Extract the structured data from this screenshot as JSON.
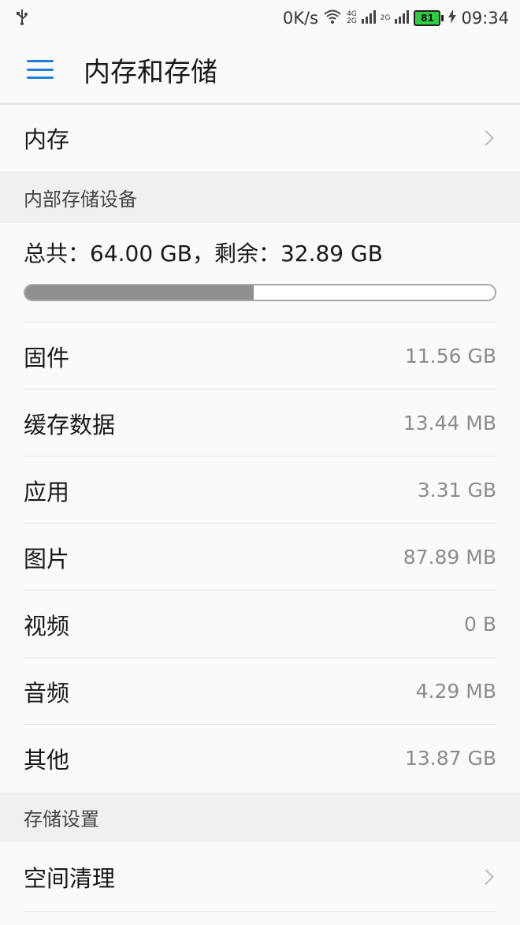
{
  "status_bar": {
    "usb_icon": "usb-icon",
    "net_speed": "0K/s",
    "wifi_icon": "wifi-icon",
    "sim1_tag_top": "4G",
    "sim1_tag_bottom": "2G",
    "sim2_tag": "2G",
    "battery_level": "81",
    "time": "09:34"
  },
  "app_bar": {
    "title": "内存和存储",
    "menu_icon": "hamburger-menu-icon"
  },
  "memory_item": {
    "label": "内存"
  },
  "internal_storage": {
    "section_title": "内部存储设备",
    "summary": "总共：64.00 GB，剩余：32.89 GB",
    "used_fraction": 0.4861,
    "items": [
      {
        "label": "固件",
        "value": "11.56 GB"
      },
      {
        "label": "缓存数据",
        "value": "13.44 MB"
      },
      {
        "label": "应用",
        "value": "3.31 GB"
      },
      {
        "label": "图片",
        "value": "87.89 MB"
      },
      {
        "label": "视频",
        "value": "0 B"
      },
      {
        "label": "音频",
        "value": "4.29 MB"
      },
      {
        "label": "其他",
        "value": "13.87 GB"
      }
    ]
  },
  "storage_settings": {
    "section_title": "存储设置",
    "cleanup_label": "空间清理"
  }
}
